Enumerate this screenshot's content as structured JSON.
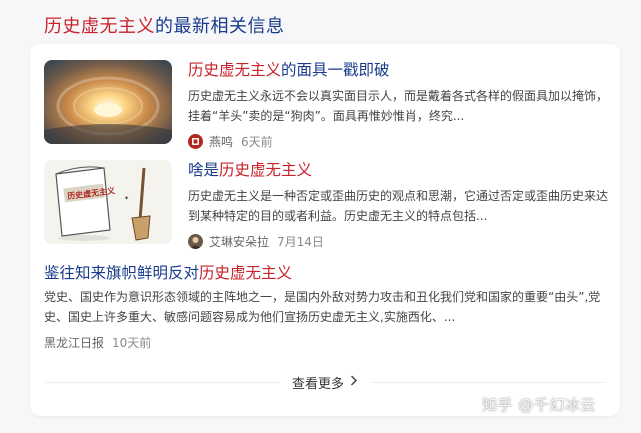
{
  "section_title": {
    "highlight": "历史虚无主义",
    "rest": "的最新相关信息"
  },
  "news": [
    {
      "title_highlight": "历史虚无主义",
      "title_rest": "的面具一戳即破",
      "summary": "历史虚无主义永远不会以真实面目示人，而是戴着各式各样的假面具加以掩饰，挂着“羊头”卖的是“狗肉”。面具再惟妙惟肖，终究...",
      "source": "燕鸣",
      "time": "6天前"
    },
    {
      "title_prefix": "啥是",
      "title_highlight": "历史虚无主义",
      "summary": "历史虚无主义是一种否定或歪曲历史的观点和思潮，它通过否定或歪曲历史来达到某种特定的目的或者利益。历史虚无主义的特点包括...",
      "source": "艾琳安朵拉",
      "time": "7月14日",
      "thumb_text": "历史虚无主义"
    },
    {
      "title_prefix": "鉴往知来旗帜鲜明反对",
      "title_highlight": "历史虚无主义",
      "summary": "党史、国史作为意识形态领域的主阵地之一，是国内外敌对势力攻击和丑化我们党和国家的重要“由头”,党史、国史上许多重大、敏感问题容易成为他们宣扬历史虚无主义,实施西化、...",
      "source": "黑龙江日报",
      "time": "10天前"
    }
  ],
  "see_more": "查看更多",
  "watermark": "知乎 @千幻冰云",
  "colors": {
    "link": "#1a3c8c",
    "highlight": "#c8232a"
  }
}
